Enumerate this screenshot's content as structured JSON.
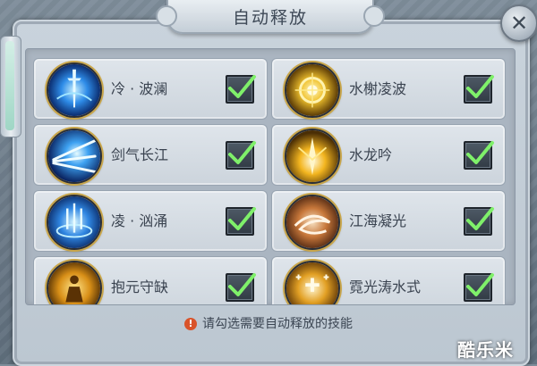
{
  "dialog": {
    "title": "自动释放",
    "close_symbol": "✕"
  },
  "skills": [
    {
      "name": "冷 · 波澜",
      "checked": true,
      "icon": "water-sword-icon",
      "color": "#2f7fe6"
    },
    {
      "name": "水榭凌波",
      "checked": true,
      "icon": "golden-orb-icon",
      "color": "#e3a91d"
    },
    {
      "name": "剑气长江",
      "checked": true,
      "icon": "sword-wave-icon",
      "color": "#2f7fe6"
    },
    {
      "name": "水龙吟",
      "checked": true,
      "icon": "golden-burst-icon",
      "color": "#e3a91d"
    },
    {
      "name": "凌 · 汹涌",
      "checked": true,
      "icon": "water-vortex-icon",
      "color": "#2f7fe6"
    },
    {
      "name": "江海凝光",
      "checked": true,
      "icon": "swirl-icon",
      "color": "#c46b2b"
    },
    {
      "name": "抱元守缺",
      "checked": true,
      "icon": "meditation-icon",
      "color": "#e3a91d"
    },
    {
      "name": "霓光涛水式",
      "checked": true,
      "icon": "sparkle-cross-icon",
      "color": "#e3a91d"
    }
  ],
  "hint": {
    "icon": "!",
    "text": "请勾选需要自动释放的技能"
  },
  "watermark": "酷乐米",
  "colors": {
    "check": "#7ff06a",
    "panel": "#bcc7d1"
  }
}
